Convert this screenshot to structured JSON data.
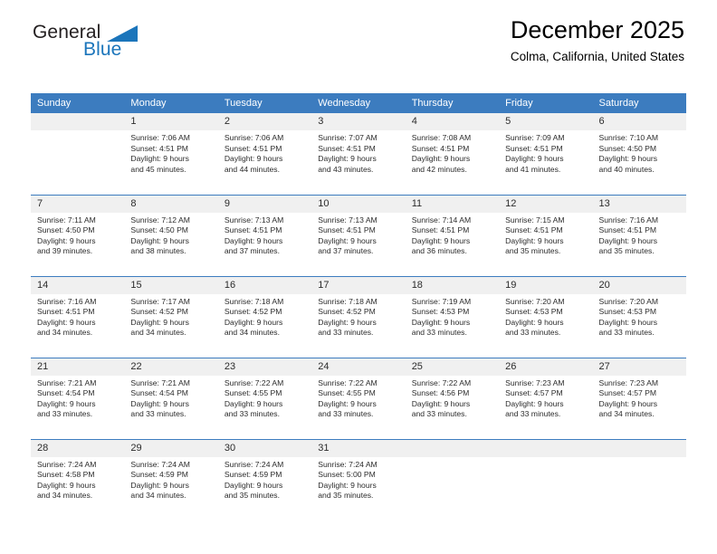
{
  "brand": {
    "name_part1": "General",
    "name_part2": "Blue",
    "flag_icon": "triangle-flag-icon",
    "accent_color": "#1b75bb"
  },
  "header": {
    "title": "December 2025",
    "subtitle": "Colma, California, United States"
  },
  "calendar": {
    "header_bg": "#3c7cbf",
    "daynum_bg": "#f0f0f0",
    "weekdays": [
      "Sunday",
      "Monday",
      "Tuesday",
      "Wednesday",
      "Thursday",
      "Friday",
      "Saturday"
    ],
    "weeks": [
      [
        {
          "day": "",
          "lines": []
        },
        {
          "day": "1",
          "lines": [
            "Sunrise: 7:06 AM",
            "Sunset: 4:51 PM",
            "Daylight: 9 hours",
            "and 45 minutes."
          ]
        },
        {
          "day": "2",
          "lines": [
            "Sunrise: 7:06 AM",
            "Sunset: 4:51 PM",
            "Daylight: 9 hours",
            "and 44 minutes."
          ]
        },
        {
          "day": "3",
          "lines": [
            "Sunrise: 7:07 AM",
            "Sunset: 4:51 PM",
            "Daylight: 9 hours",
            "and 43 minutes."
          ]
        },
        {
          "day": "4",
          "lines": [
            "Sunrise: 7:08 AM",
            "Sunset: 4:51 PM",
            "Daylight: 9 hours",
            "and 42 minutes."
          ]
        },
        {
          "day": "5",
          "lines": [
            "Sunrise: 7:09 AM",
            "Sunset: 4:51 PM",
            "Daylight: 9 hours",
            "and 41 minutes."
          ]
        },
        {
          "day": "6",
          "lines": [
            "Sunrise: 7:10 AM",
            "Sunset: 4:50 PM",
            "Daylight: 9 hours",
            "and 40 minutes."
          ]
        }
      ],
      [
        {
          "day": "7",
          "lines": [
            "Sunrise: 7:11 AM",
            "Sunset: 4:50 PM",
            "Daylight: 9 hours",
            "and 39 minutes."
          ]
        },
        {
          "day": "8",
          "lines": [
            "Sunrise: 7:12 AM",
            "Sunset: 4:50 PM",
            "Daylight: 9 hours",
            "and 38 minutes."
          ]
        },
        {
          "day": "9",
          "lines": [
            "Sunrise: 7:13 AM",
            "Sunset: 4:51 PM",
            "Daylight: 9 hours",
            "and 37 minutes."
          ]
        },
        {
          "day": "10",
          "lines": [
            "Sunrise: 7:13 AM",
            "Sunset: 4:51 PM",
            "Daylight: 9 hours",
            "and 37 minutes."
          ]
        },
        {
          "day": "11",
          "lines": [
            "Sunrise: 7:14 AM",
            "Sunset: 4:51 PM",
            "Daylight: 9 hours",
            "and 36 minutes."
          ]
        },
        {
          "day": "12",
          "lines": [
            "Sunrise: 7:15 AM",
            "Sunset: 4:51 PM",
            "Daylight: 9 hours",
            "and 35 minutes."
          ]
        },
        {
          "day": "13",
          "lines": [
            "Sunrise: 7:16 AM",
            "Sunset: 4:51 PM",
            "Daylight: 9 hours",
            "and 35 minutes."
          ]
        }
      ],
      [
        {
          "day": "14",
          "lines": [
            "Sunrise: 7:16 AM",
            "Sunset: 4:51 PM",
            "Daylight: 9 hours",
            "and 34 minutes."
          ]
        },
        {
          "day": "15",
          "lines": [
            "Sunrise: 7:17 AM",
            "Sunset: 4:52 PM",
            "Daylight: 9 hours",
            "and 34 minutes."
          ]
        },
        {
          "day": "16",
          "lines": [
            "Sunrise: 7:18 AM",
            "Sunset: 4:52 PM",
            "Daylight: 9 hours",
            "and 34 minutes."
          ]
        },
        {
          "day": "17",
          "lines": [
            "Sunrise: 7:18 AM",
            "Sunset: 4:52 PM",
            "Daylight: 9 hours",
            "and 33 minutes."
          ]
        },
        {
          "day": "18",
          "lines": [
            "Sunrise: 7:19 AM",
            "Sunset: 4:53 PM",
            "Daylight: 9 hours",
            "and 33 minutes."
          ]
        },
        {
          "day": "19",
          "lines": [
            "Sunrise: 7:20 AM",
            "Sunset: 4:53 PM",
            "Daylight: 9 hours",
            "and 33 minutes."
          ]
        },
        {
          "day": "20",
          "lines": [
            "Sunrise: 7:20 AM",
            "Sunset: 4:53 PM",
            "Daylight: 9 hours",
            "and 33 minutes."
          ]
        }
      ],
      [
        {
          "day": "21",
          "lines": [
            "Sunrise: 7:21 AM",
            "Sunset: 4:54 PM",
            "Daylight: 9 hours",
            "and 33 minutes."
          ]
        },
        {
          "day": "22",
          "lines": [
            "Sunrise: 7:21 AM",
            "Sunset: 4:54 PM",
            "Daylight: 9 hours",
            "and 33 minutes."
          ]
        },
        {
          "day": "23",
          "lines": [
            "Sunrise: 7:22 AM",
            "Sunset: 4:55 PM",
            "Daylight: 9 hours",
            "and 33 minutes."
          ]
        },
        {
          "day": "24",
          "lines": [
            "Sunrise: 7:22 AM",
            "Sunset: 4:55 PM",
            "Daylight: 9 hours",
            "and 33 minutes."
          ]
        },
        {
          "day": "25",
          "lines": [
            "Sunrise: 7:22 AM",
            "Sunset: 4:56 PM",
            "Daylight: 9 hours",
            "and 33 minutes."
          ]
        },
        {
          "day": "26",
          "lines": [
            "Sunrise: 7:23 AM",
            "Sunset: 4:57 PM",
            "Daylight: 9 hours",
            "and 33 minutes."
          ]
        },
        {
          "day": "27",
          "lines": [
            "Sunrise: 7:23 AM",
            "Sunset: 4:57 PM",
            "Daylight: 9 hours",
            "and 34 minutes."
          ]
        }
      ],
      [
        {
          "day": "28",
          "lines": [
            "Sunrise: 7:24 AM",
            "Sunset: 4:58 PM",
            "Daylight: 9 hours",
            "and 34 minutes."
          ]
        },
        {
          "day": "29",
          "lines": [
            "Sunrise: 7:24 AM",
            "Sunset: 4:59 PM",
            "Daylight: 9 hours",
            "and 34 minutes."
          ]
        },
        {
          "day": "30",
          "lines": [
            "Sunrise: 7:24 AM",
            "Sunset: 4:59 PM",
            "Daylight: 9 hours",
            "and 35 minutes."
          ]
        },
        {
          "day": "31",
          "lines": [
            "Sunrise: 7:24 AM",
            "Sunset: 5:00 PM",
            "Daylight: 9 hours",
            "and 35 minutes."
          ]
        },
        {
          "day": "",
          "lines": []
        },
        {
          "day": "",
          "lines": []
        },
        {
          "day": "",
          "lines": []
        }
      ]
    ]
  }
}
